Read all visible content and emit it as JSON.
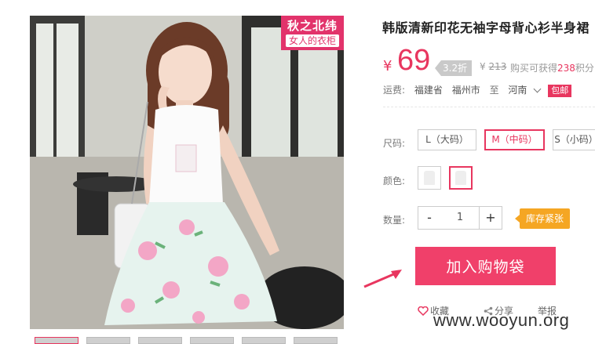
{
  "image": {
    "brand_line1": "秋之北纬",
    "brand_line2": "女人的衣柜"
  },
  "product": {
    "title": "韩版清新印花无袖字母背心衫半身裙",
    "currency": "¥",
    "price": "69",
    "discount": "3.2折",
    "orig_currency": "¥",
    "orig_price": "213",
    "points_prefix": "购买可获得",
    "points": "238",
    "points_suffix": "积分"
  },
  "shipping": {
    "label": "运费:",
    "from_province": "福建省",
    "from_city": "福州市",
    "to_word": "至",
    "to_province": "河南",
    "badge": "包邮"
  },
  "size": {
    "label": "尺码:",
    "options": [
      "L（大码）",
      "M（中码）",
      "S（小码）"
    ],
    "selected": 1
  },
  "color": {
    "label": "颜色:",
    "selected": 1
  },
  "quantity": {
    "label": "数量:",
    "minus": "-",
    "value": "1",
    "plus": "+",
    "stock_tip": "库存紧张"
  },
  "cart": {
    "button_label": "加入购物袋"
  },
  "actions": {
    "favorite": "收藏",
    "share": "分享",
    "report": "举报"
  },
  "watermark": "www.wooyun.org",
  "colors": {
    "accent": "#e8365f",
    "cart_button": "#f0406a",
    "stock_tip": "#f5a623",
    "arrow": "#e8365f"
  }
}
